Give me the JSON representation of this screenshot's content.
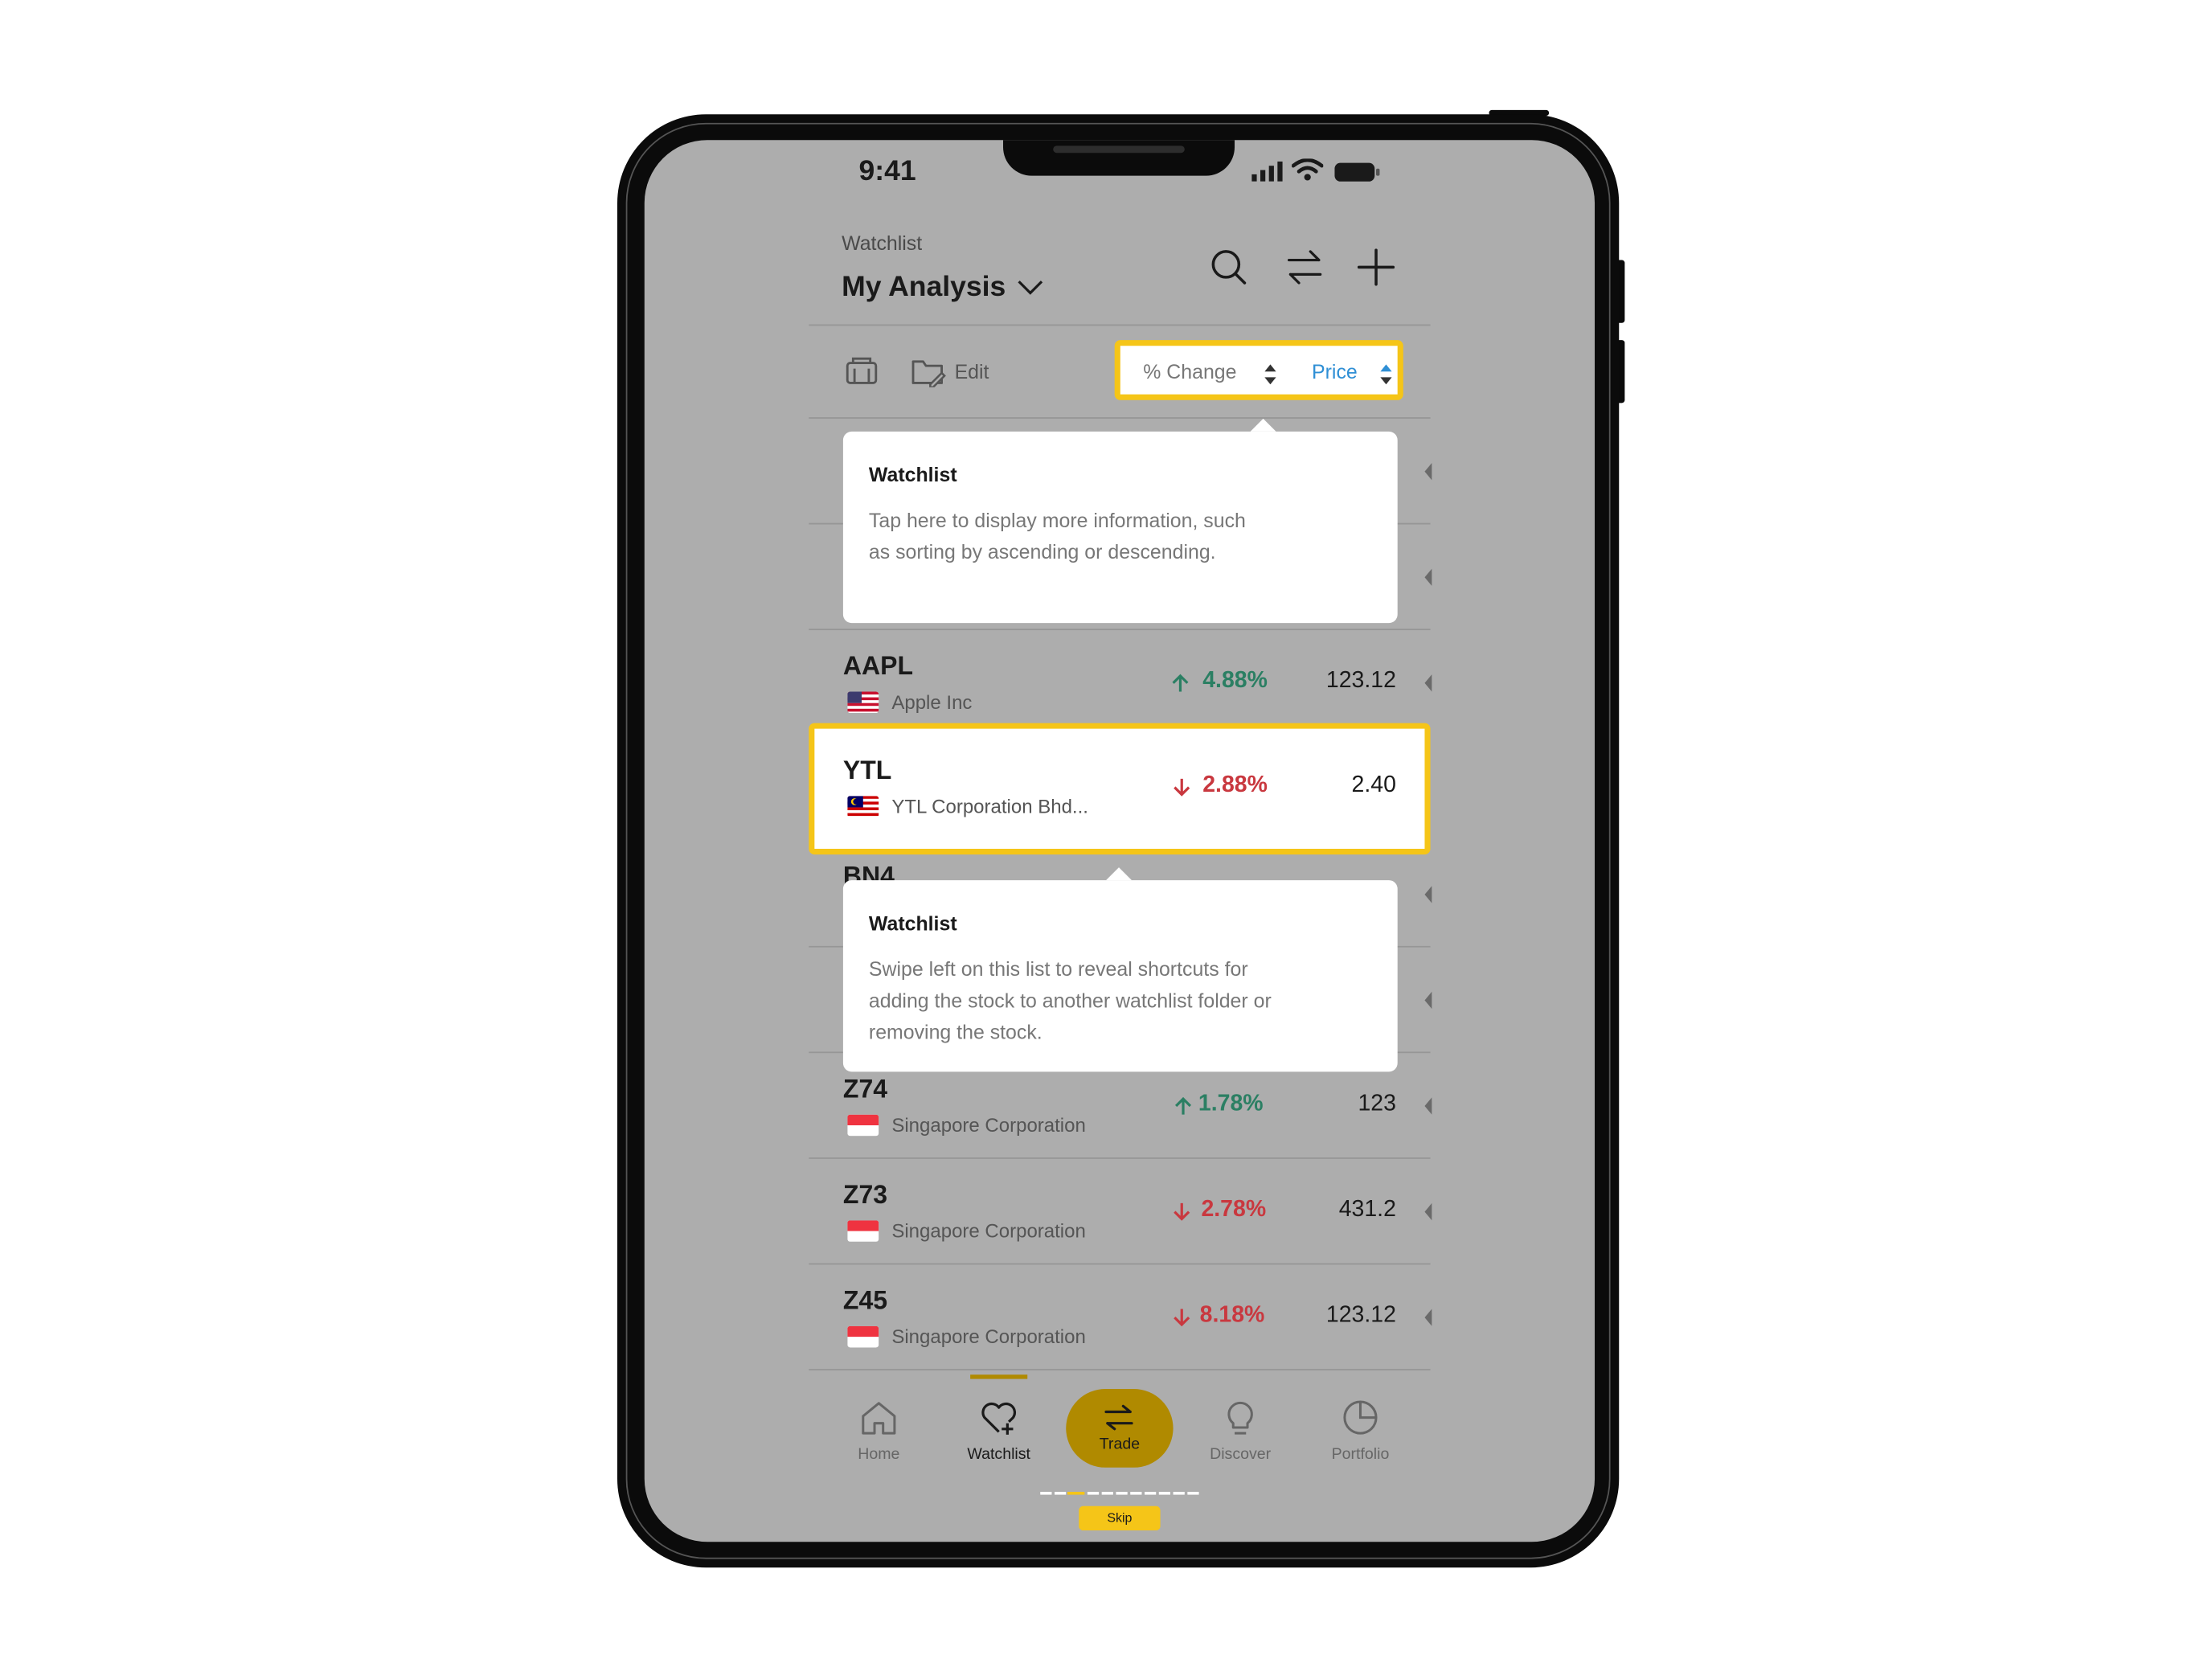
{
  "status_bar": {
    "time": "9:41"
  },
  "header": {
    "subtitle": "Watchlist",
    "title": "My Analysis"
  },
  "toolbar": {
    "edit_label": "Edit",
    "sort_change_label": "% Change",
    "sort_price_label": "Price"
  },
  "tooltips": [
    {
      "title": "Watchlist",
      "body": "Tap here to display more information, such as sorting by ascending or descending."
    },
    {
      "title": "Watchlist",
      "body": "Swipe left on this list to reveal shortcuts for adding the stock to another watchlist folder or removing the stock."
    }
  ],
  "rows": [
    {
      "symbol": "AAPL",
      "name": "Apple Inc",
      "change": "4.88%",
      "direction": "up",
      "price": "123.12",
      "flag": "us"
    },
    {
      "symbol": "YTL",
      "name": "YTL Corporation Bhd...",
      "change": "2.88%",
      "direction": "down",
      "price": "2.40",
      "flag": "my"
    },
    {
      "symbol": "BN4",
      "name": "",
      "change": "",
      "direction": "",
      "price": "",
      "flag": ""
    },
    {
      "symbol": "Z74",
      "name": "Singapore Corporation",
      "change": "1.78%",
      "direction": "up",
      "price": "123",
      "flag": "sg"
    },
    {
      "symbol": "Z73",
      "name": "Singapore Corporation",
      "change": "2.78%",
      "direction": "down",
      "price": "431.2",
      "flag": "sg"
    },
    {
      "symbol": "Z45",
      "name": "Singapore Corporation",
      "change": "8.18%",
      "direction": "down",
      "price": "123.12",
      "flag": "sg"
    }
  ],
  "nav": {
    "home": "Home",
    "watchlist": "Watchlist",
    "trade": "Trade",
    "discover": "Discover",
    "portfolio": "Portfolio"
  },
  "onboarding": {
    "skip_label": "Skip",
    "total_steps": 11,
    "current_step": 2
  },
  "colors": {
    "accent": "#f5c518",
    "trade_pill": "#b08a00",
    "up": "#2b7f63",
    "down": "#c9383f",
    "link": "#2f8fd5"
  }
}
